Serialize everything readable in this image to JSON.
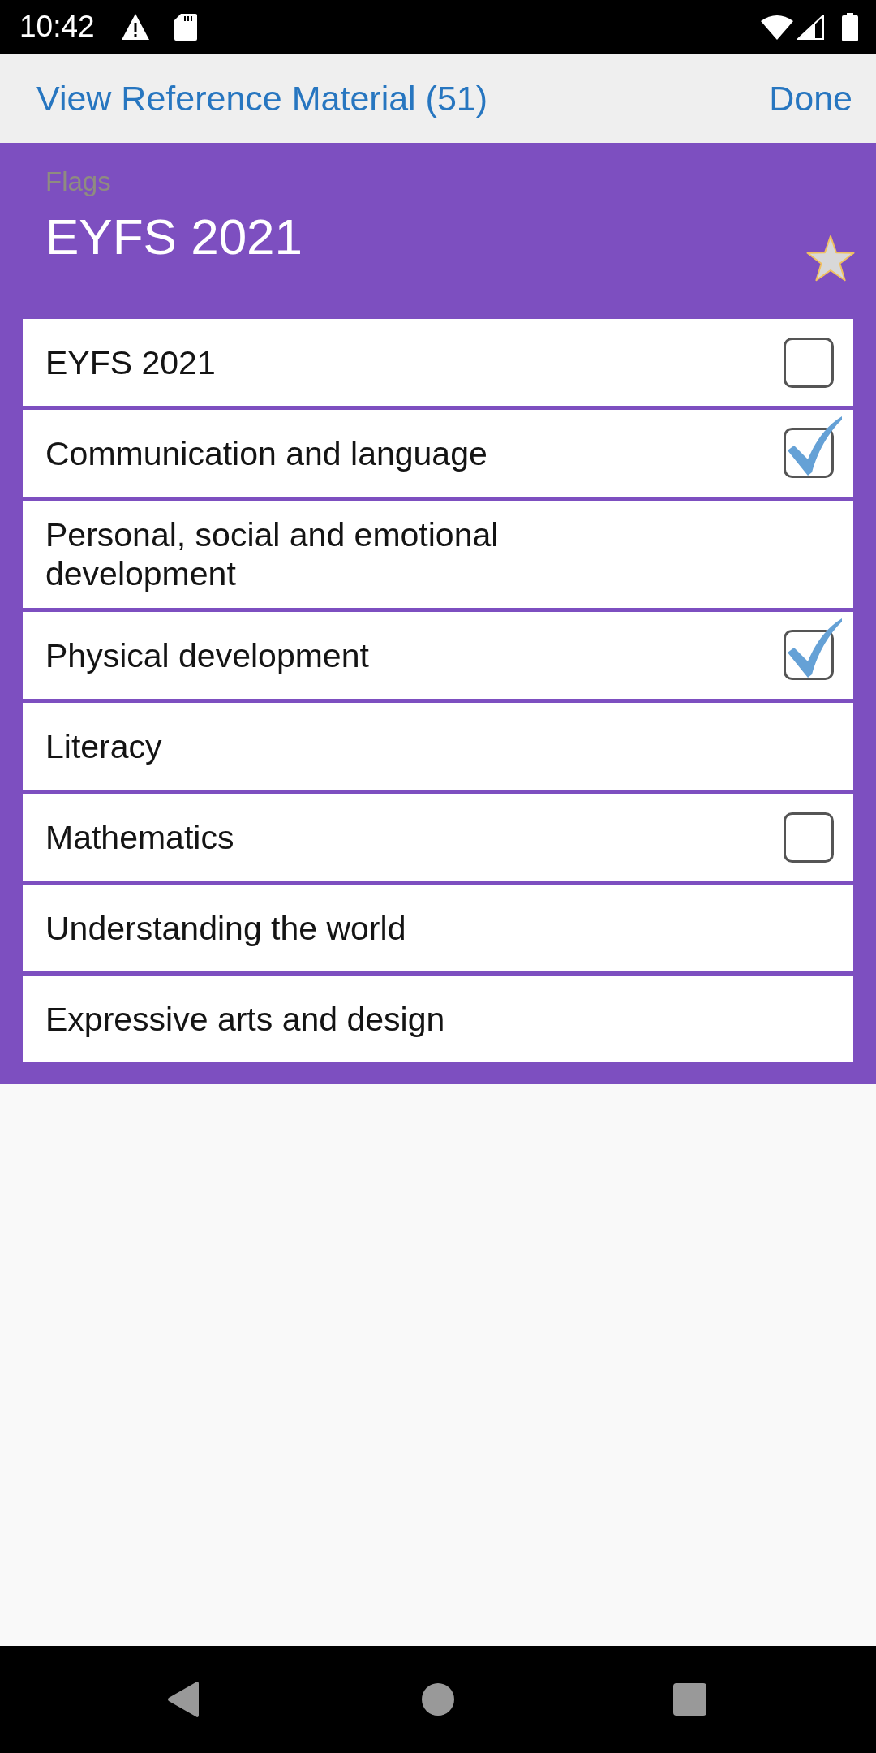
{
  "status_bar": {
    "time": "10:42"
  },
  "top_bar": {
    "title": "View Reference Material (51)",
    "action": "Done"
  },
  "header": {
    "subtitle": "Flags",
    "title": "EYFS 2021",
    "starred": false
  },
  "items": [
    {
      "label": "EYFS 2021",
      "kind": "checkbox",
      "checked": false
    },
    {
      "label": "Communication and language",
      "kind": "checkbox",
      "checked": true
    },
    {
      "label": "Personal, social and emotional development",
      "kind": "plain"
    },
    {
      "label": "Physical development",
      "kind": "checkbox",
      "checked": true
    },
    {
      "label": "Literacy",
      "kind": "plain"
    },
    {
      "label": "Mathematics",
      "kind": "checkbox",
      "checked": false
    },
    {
      "label": "Understanding the world",
      "kind": "plain"
    },
    {
      "label": "Expressive arts and design",
      "kind": "plain"
    }
  ]
}
